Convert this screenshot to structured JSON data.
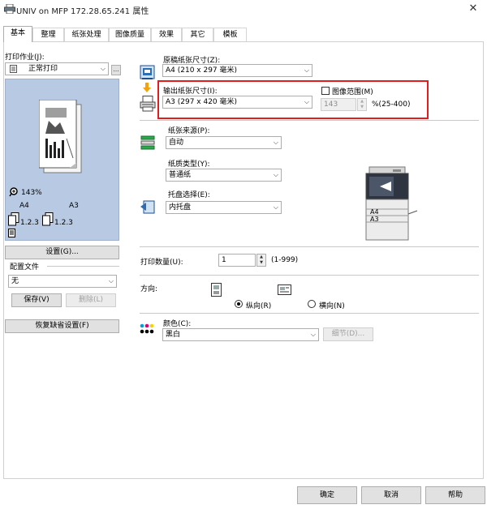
{
  "window": {
    "title": "UNIV on MFP 172.28.65.241 属性",
    "close_glyph": "✕"
  },
  "tabs": [
    "基本",
    "整理",
    "纸张处理",
    "图像质量",
    "效果",
    "其它",
    "模板"
  ],
  "left": {
    "print_job_label": "打印作业(J):",
    "print_job_value": "正常打印",
    "zoom_text": "143%",
    "paper_from": "A4",
    "paper_to": "A3",
    "page_seq_1": "1.2.3",
    "page_seq_2": "1.2.3",
    "settings_button": "设置(G)...",
    "profile_label": "配置文件",
    "profile_value": "无",
    "save_button": "保存(V)",
    "delete_button": "删除(L)",
    "restore_button": "恢复缺省设置(F)"
  },
  "right": {
    "original_size_label": "原稿纸张尺寸(Z):",
    "original_size_value": "A4 (210 x 297 毫米)",
    "output_size_label": "输出纸张尺寸(I):",
    "output_size_value": "A3 (297 x 420 毫米)",
    "image_range_label": "图像范围(M)",
    "image_range_value": "143",
    "image_range_unit": "%(25-400)",
    "paper_source_label": "纸张来源(P):",
    "paper_source_value": "自动",
    "paper_type_label": "纸质类型(Y):",
    "paper_type_value": "普通纸",
    "tray_label": "托盘选择(E):",
    "tray_value": "内托盘",
    "printer_tray_a4": "A4",
    "printer_tray_a3": "A3",
    "copies_label": "打印数量(U):",
    "copies_value": "1",
    "copies_range": "(1-999)",
    "orientation_label": "方向:",
    "portrait_label": "纵向(R)",
    "landscape_label": "横向(N)",
    "color_label": "颜色(C):",
    "color_value": "黑白",
    "details_button": "细节(D)..."
  },
  "footer": {
    "ok": "确定",
    "cancel": "取消",
    "help": "帮助"
  },
  "colors": {
    "highlight_border": "#e11e1e",
    "preview_bg": "#b8cae3"
  }
}
